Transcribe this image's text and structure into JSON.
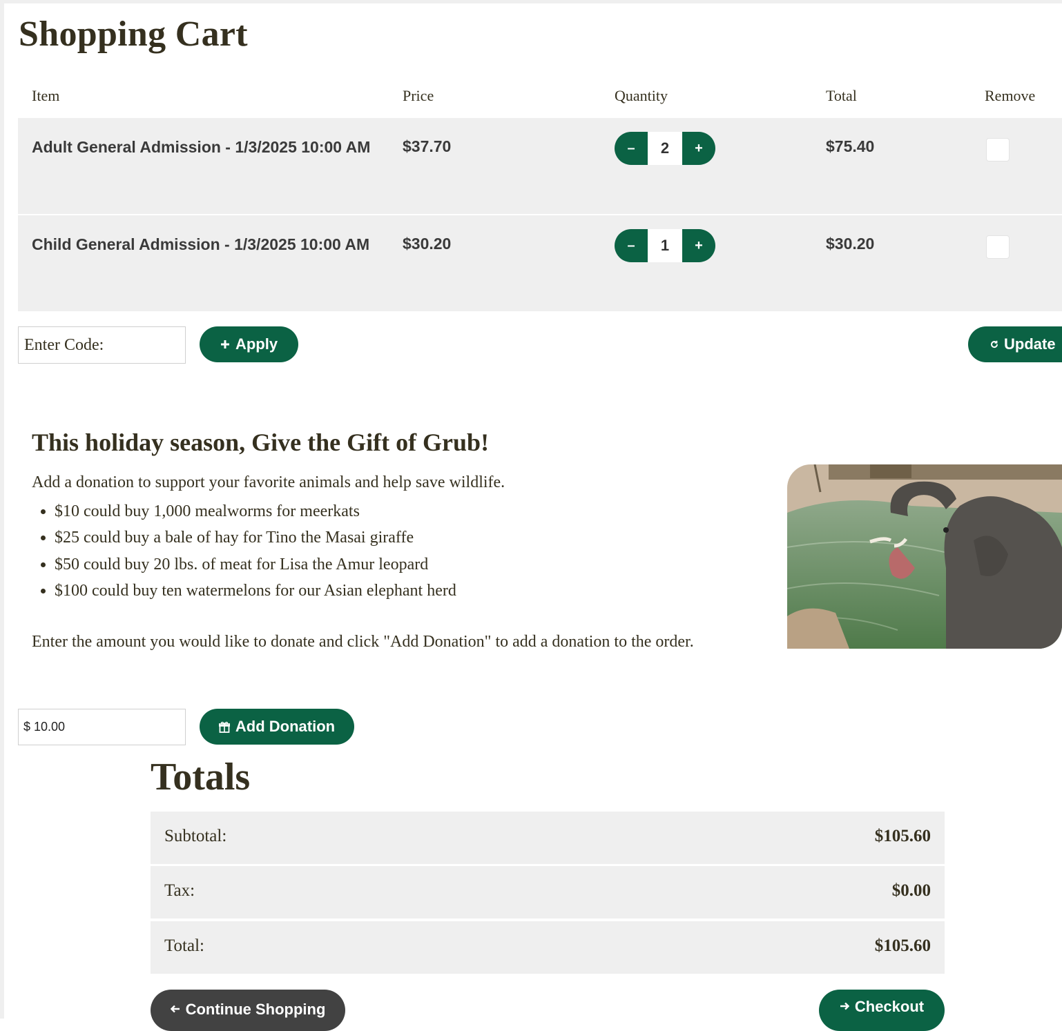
{
  "page": {
    "title": "Shopping Cart"
  },
  "cart": {
    "headers": {
      "item": "Item",
      "price": "Price",
      "quantity": "Quantity",
      "total": "Total",
      "remove": "Remove"
    },
    "rows": [
      {
        "item": "Adult General Admission - 1/3/2025 10:00 AM",
        "price": "$37.70",
        "quantity": "2",
        "total": "$75.40",
        "remove_checked": false
      },
      {
        "item": "Child General Admission - 1/3/2025 10:00 AM",
        "price": "$30.20",
        "quantity": "1",
        "total": "$30.20",
        "remove_checked": false
      }
    ],
    "qty_minus_label": "–",
    "qty_plus_label": "+"
  },
  "promo_code": {
    "placeholder": "Enter Code:",
    "value": "",
    "apply_label": "Apply",
    "update_label": "Update"
  },
  "donation": {
    "title": "This holiday season, Give the Gift of Grub!",
    "intro": "Add a donation to support your favorite animals and help save wildlife.",
    "items": [
      "$10 could buy 1,000 mealworms for meerkats",
      "$25 could buy a bale of hay for Tino the Masai giraffe",
      "$50 could buy 20 lbs. of meat for Lisa the Amur leopard",
      "$100 could buy ten watermelons for our Asian elephant herd"
    ],
    "instructions": "Enter the amount you would like to donate and click \"Add Donation\" to add a donation to the order.",
    "amount_value": "$ 10.00",
    "add_label": "Add Donation",
    "image_subject": "elephant-photo"
  },
  "totals": {
    "title": "Totals",
    "subtotal_label": "Subtotal:",
    "subtotal_value": "$105.60",
    "tax_label": "Tax:",
    "tax_value": "$0.00",
    "total_label": "Total:",
    "total_value": "$105.60"
  },
  "actions": {
    "continue_label": "Continue Shopping",
    "checkout_label": "Checkout"
  },
  "colors": {
    "brand_green": "#0b6244",
    "dark_button": "#424242",
    "row_bg": "#efefef",
    "heading_text": "#35301f"
  }
}
